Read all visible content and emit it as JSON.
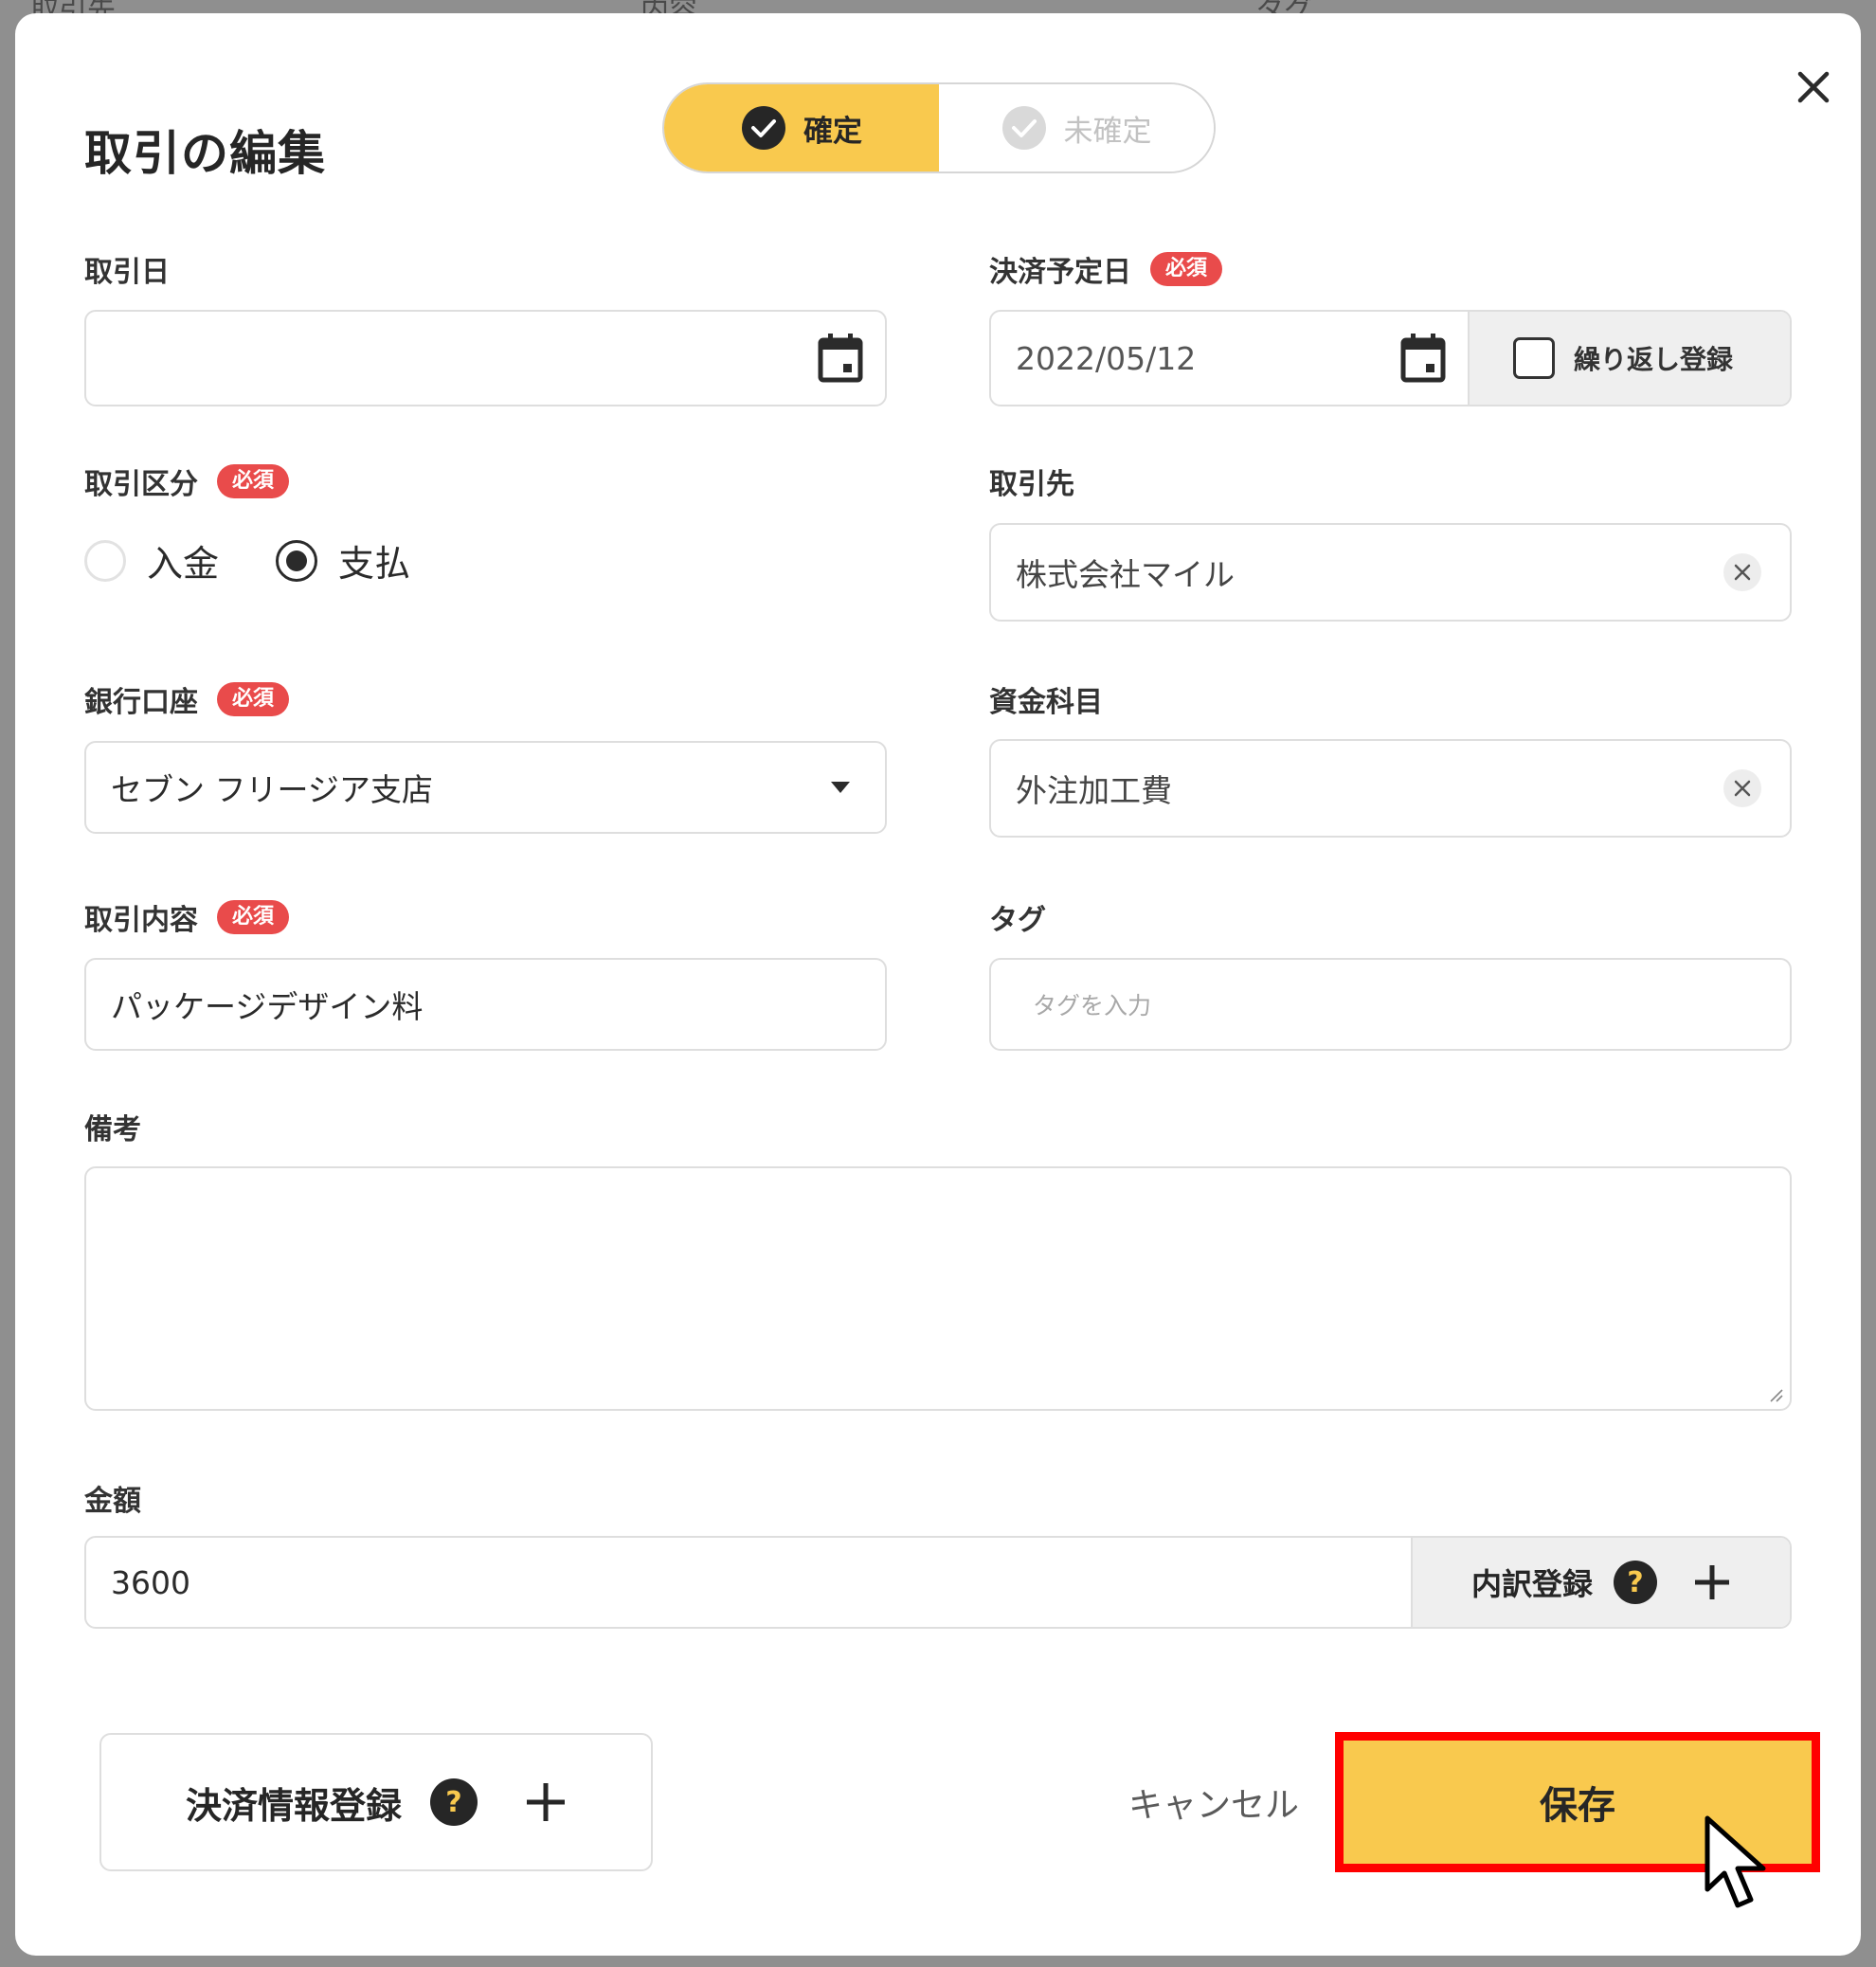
{
  "backdrop": {
    "col1": "取引先",
    "col2": "内容",
    "col3": "タグ"
  },
  "modal": {
    "title": "取引の編集",
    "status_toggle": {
      "confirmed": "確定",
      "unconfirmed": "未確定"
    },
    "required_badge": "必須",
    "transaction_date": {
      "label": "取引日",
      "value": ""
    },
    "settlement_date": {
      "label": "決済予定日",
      "value": "2022/05/12",
      "repeat_label": "繰り返し登録",
      "repeat_checked": false
    },
    "transaction_type": {
      "label": "取引区分",
      "options": [
        "入金",
        "支払"
      ],
      "selected": "支払"
    },
    "partner": {
      "label": "取引先",
      "value": "株式会社マイル"
    },
    "bank_account": {
      "label": "銀行口座",
      "value": "セブン フリージア支店"
    },
    "fund_item": {
      "label": "資金科目",
      "value": "外注加工費"
    },
    "description": {
      "label": "取引内容",
      "value": "パッケージデザイン料"
    },
    "tags": {
      "label": "タグ",
      "placeholder": "タグを入力"
    },
    "notes": {
      "label": "備考",
      "value": ""
    },
    "amount": {
      "label": "金額",
      "value": "3600",
      "breakdown_label": "内訳登録"
    },
    "help_icon_text": "?",
    "payment_info_button": "決済情報登録",
    "cancel_button": "キャンセル",
    "save_button": "保存"
  },
  "colors": {
    "accent": "#f9c94e",
    "required": "#e94b4b",
    "highlight": "#ff0000"
  },
  "icons": [
    "close-icon",
    "check-circle-icon",
    "calendar-icon",
    "clear-icon",
    "dropdown-caret-icon",
    "help-icon",
    "plus-icon",
    "resize-handle-icon",
    "mouse-cursor-icon"
  ]
}
